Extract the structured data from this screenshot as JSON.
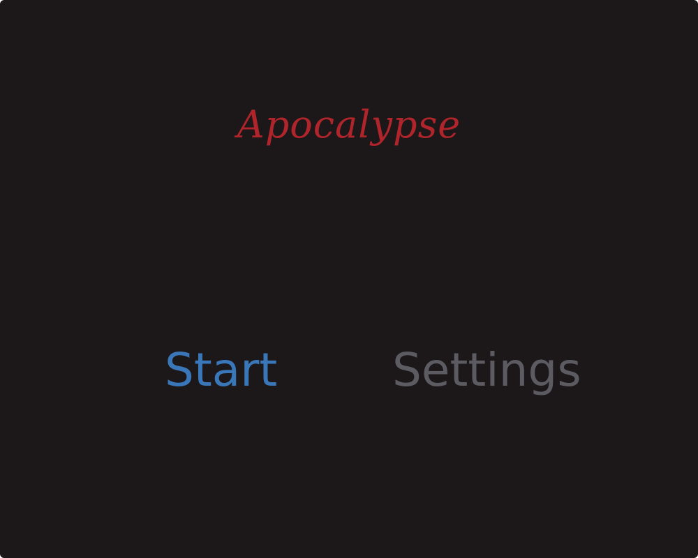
{
  "game": {
    "title": "Apocalypse",
    "menu": {
      "start_label": "Start",
      "settings_label": "Settings"
    }
  },
  "colors": {
    "background": "#1c1819",
    "title": "#b0252b",
    "start_active": "#3a77b8",
    "settings_inactive": "#5d5b62"
  }
}
